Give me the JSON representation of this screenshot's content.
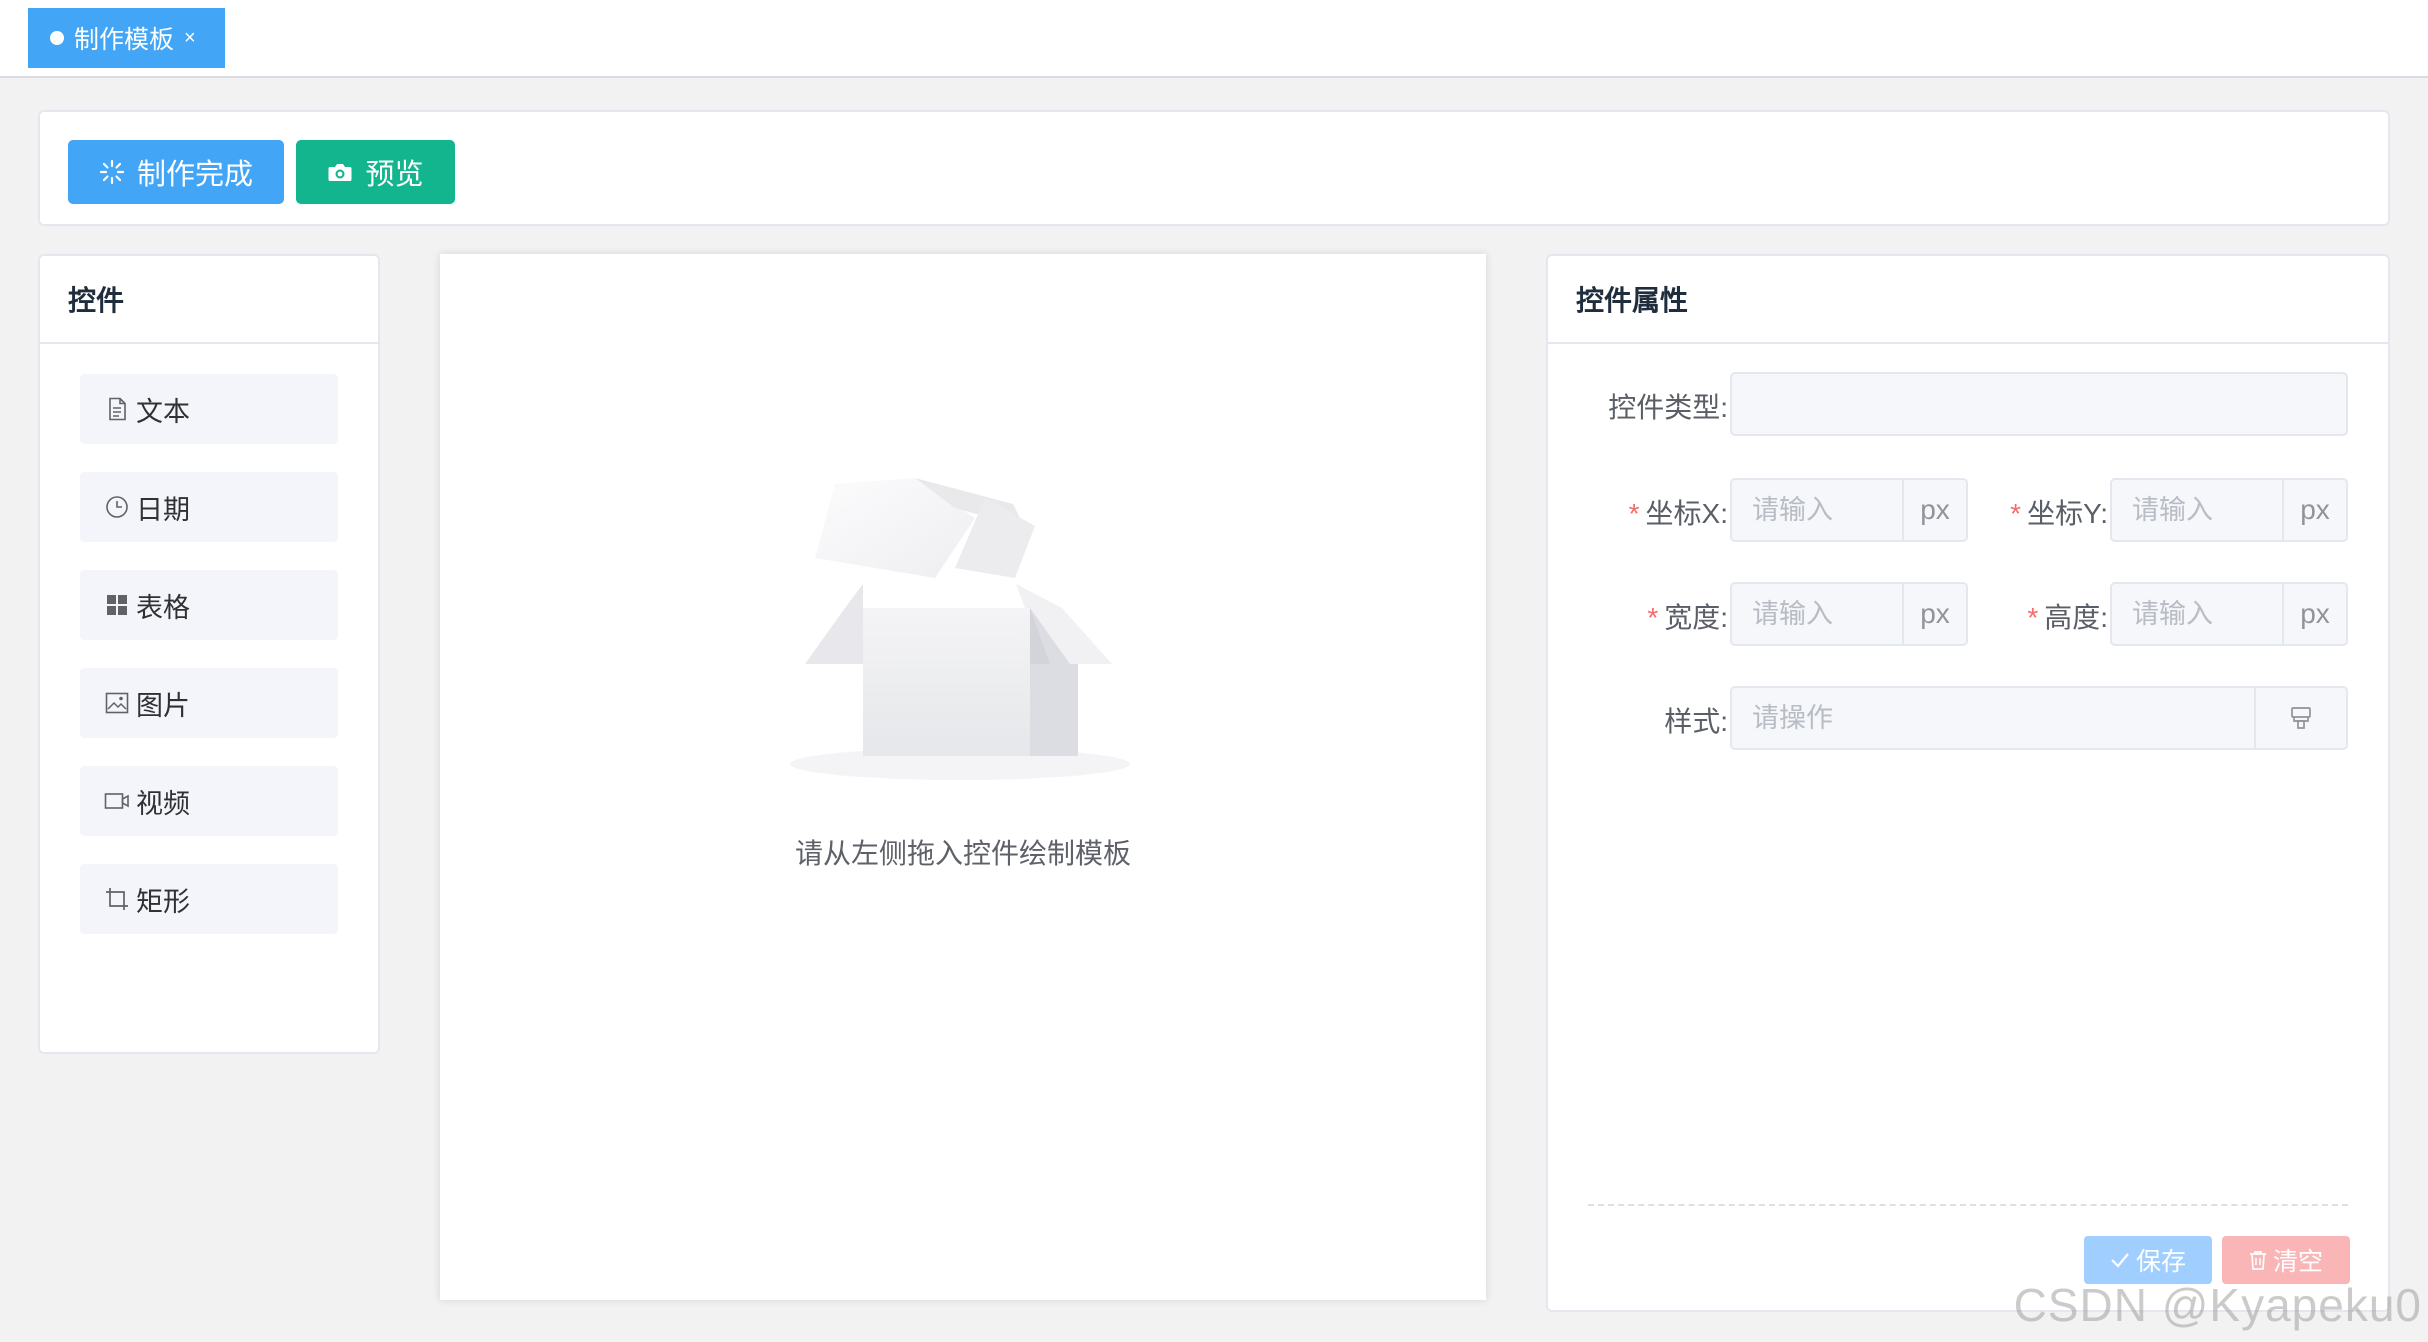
{
  "tabs": [
    {
      "label": "制作模板",
      "close": "×"
    }
  ],
  "toolbar": {
    "done_label": "制作完成",
    "preview_label": "预览"
  },
  "widgets_panel": {
    "title": "控件",
    "items": [
      {
        "label": "文本",
        "icon": "document-icon"
      },
      {
        "label": "日期",
        "icon": "clock-icon"
      },
      {
        "label": "表格",
        "icon": "grid-icon"
      },
      {
        "label": "图片",
        "icon": "picture-icon"
      },
      {
        "label": "视频",
        "icon": "video-camera-icon"
      },
      {
        "label": "矩形",
        "icon": "crop-icon"
      }
    ]
  },
  "canvas": {
    "empty_text": "请从左侧拖入控件绘制模板"
  },
  "props_panel": {
    "title": "控件属性",
    "type_label": "控件类型:",
    "type_value": "",
    "x_label": "坐标X:",
    "y_label": "坐标Y:",
    "width_label": "宽度:",
    "height_label": "高度:",
    "style_label": "样式:",
    "input_placeholder": "请输入",
    "style_placeholder": "请操作",
    "unit": "px",
    "required_mark": "*",
    "save_label": "保存",
    "clear_label": "清空"
  },
  "watermark": "CSDN @Kyapeku0",
  "colors": {
    "primary": "#42a5f5",
    "success": "#13b58f",
    "save_disabled": "#a0cfff",
    "clear_disabled": "#fab6b6"
  }
}
